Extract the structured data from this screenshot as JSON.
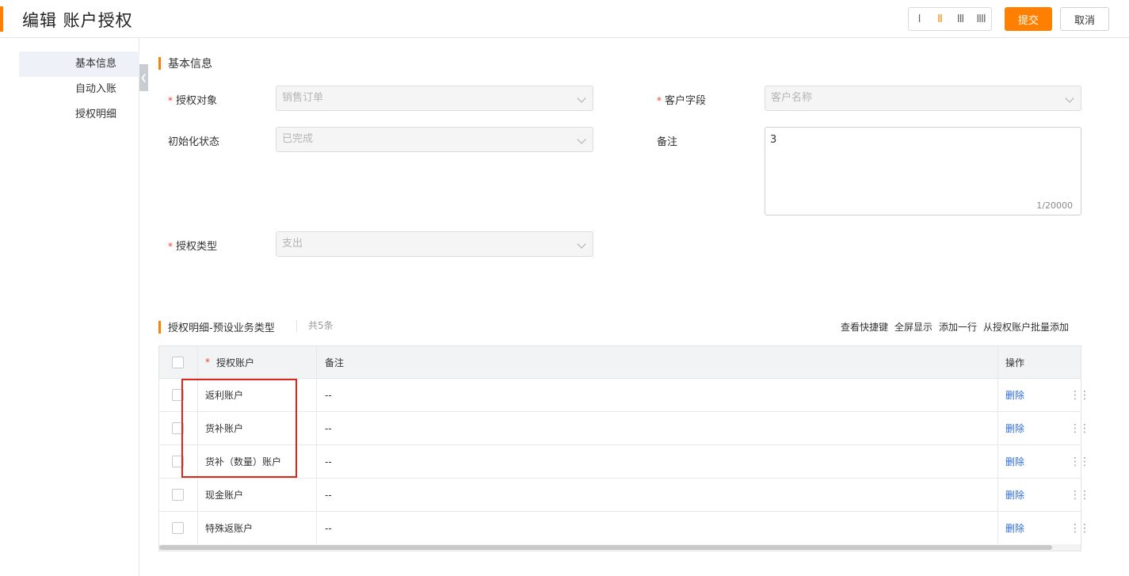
{
  "header": {
    "title": "编辑 账户授权",
    "layout_options": [
      "I",
      "II",
      "III",
      "IIII"
    ],
    "active_layout": 1,
    "submit_label": "提交",
    "cancel_label": "取消"
  },
  "sidenav": {
    "items": [
      {
        "label": "基本信息",
        "active": true
      },
      {
        "label": "自动入账",
        "active": false
      },
      {
        "label": "授权明细",
        "active": false
      }
    ]
  },
  "basic_info": {
    "title": "基本信息",
    "auth_object": {
      "label": "授权对象",
      "required": true,
      "value": "销售订单"
    },
    "customer_field": {
      "label": "客户字段",
      "required": true,
      "value": "客户名称"
    },
    "init_status": {
      "label": "初始化状态",
      "required": false,
      "value": "已完成"
    },
    "remark": {
      "label": "备注",
      "value": "3",
      "counter": "1/20000"
    },
    "auth_type": {
      "label": "授权类型",
      "required": true,
      "value": "支出"
    }
  },
  "detail": {
    "title": "授权明细-预设业务类型",
    "count": "共5条",
    "actions": {
      "shortcut": "查看快捷键",
      "fullscreen": "全屏显示",
      "add_row": "添加一行",
      "batch_add": "从授权账户批量添加"
    },
    "columns": {
      "account": "授权账户",
      "remark": "备注",
      "ops": "操作"
    },
    "rows": [
      {
        "account": "返利账户",
        "remark": "--",
        "op": "删除"
      },
      {
        "account": "货补账户",
        "remark": "--",
        "op": "删除"
      },
      {
        "account": "货补（数量）账户",
        "remark": "--",
        "op": "删除"
      },
      {
        "account": "现金账户",
        "remark": "--",
        "op": "删除"
      },
      {
        "account": "特殊返账户",
        "remark": "--",
        "op": "删除"
      }
    ]
  },
  "colors": {
    "accent": "#ff8000",
    "link": "#2e6bd6",
    "required": "#f04134",
    "highlight_box": "#d9281c"
  }
}
